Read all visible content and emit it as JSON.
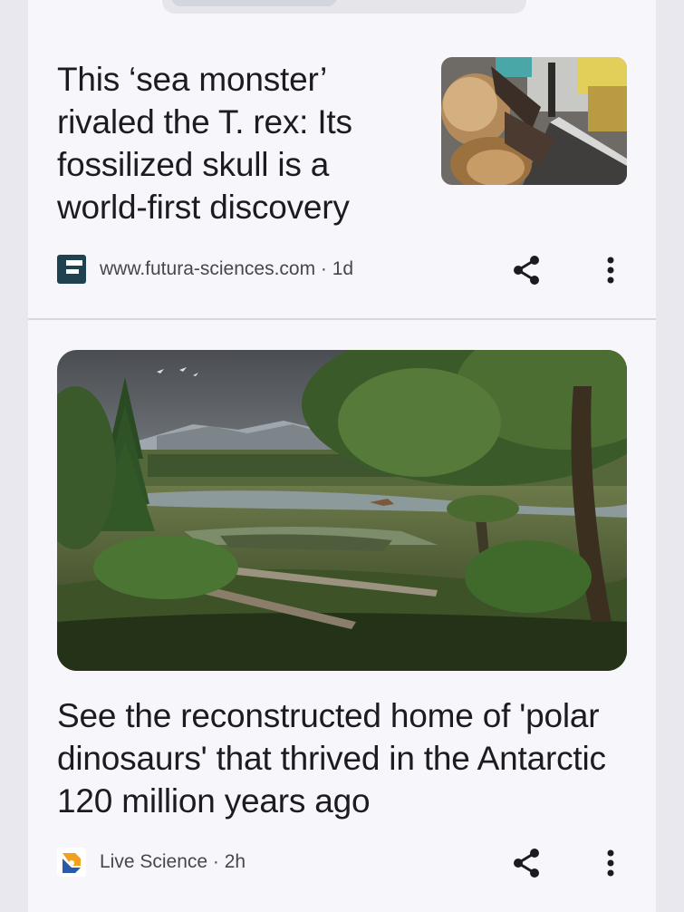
{
  "articles": [
    {
      "headline": "This ‘sea monster’ rivaled the T. rex: Its fossilized skull is a world-first discovery",
      "source": "www.futura-sciences.com",
      "age": "1d",
      "source_icon": "futura-logo-icon",
      "image": "fossil-skull-thumbnail"
    },
    {
      "headline": "See the reconstructed home of 'polar dinosaurs' that thrived in the Antarctic 120 million years ago",
      "source": "Live Science",
      "age": "2h",
      "source_icon": "live-science-logo-icon",
      "image": "polar-dinosaur-landscape"
    }
  ],
  "separator": " · ",
  "icons": {
    "share": "share-icon",
    "more": "more-vert-icon"
  },
  "colors": {
    "background": "#f7f7fb",
    "text": "#1c1b1f",
    "meta_text": "#47464f",
    "divider": "#d9d9dd"
  }
}
